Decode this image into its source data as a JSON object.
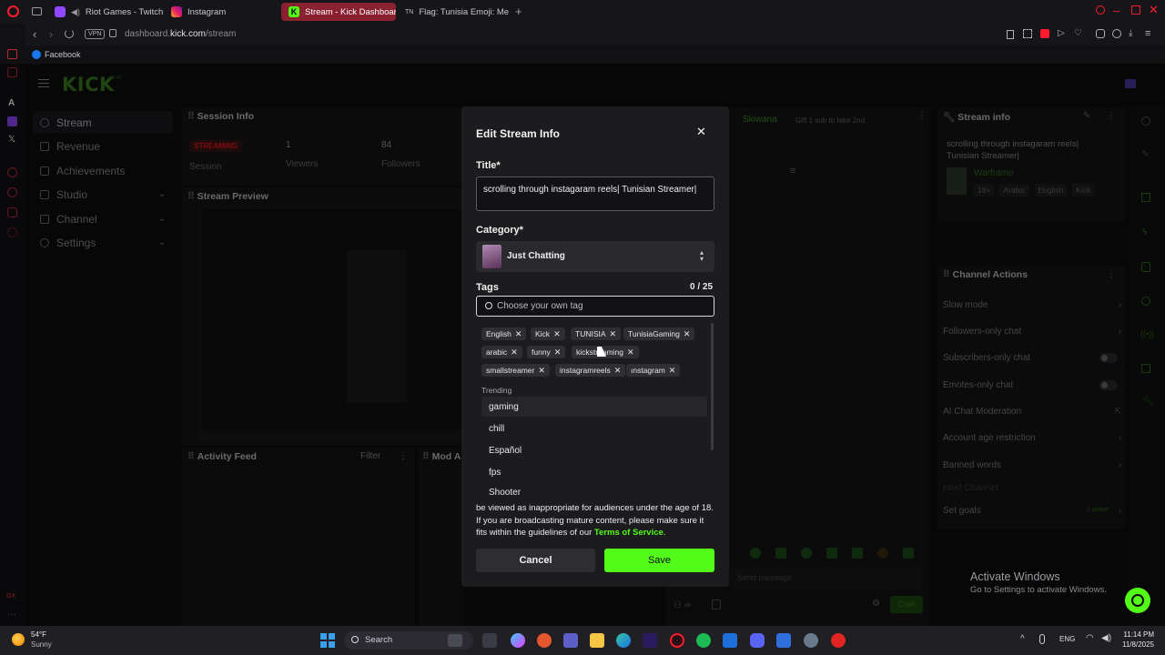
{
  "browser": {
    "tabs": [
      {
        "label": "Riot Games - Twitch",
        "icon": "twitch-icon",
        "active": false
      },
      {
        "label": "Instagram",
        "icon": "instagram-icon",
        "active": false
      },
      {
        "label": "Stream - Kick Dashboard",
        "icon": "kick-icon",
        "active": true
      },
      {
        "label": "Flag: Tunisia Emoji: Me",
        "icon": "emojipedia-icon",
        "active": false
      }
    ],
    "vpn_label": "VPN",
    "url_host": "dashboard.",
    "url_domain": "kick.com",
    "url_path": "/stream",
    "bookmark": "Facebook"
  },
  "sidebar": {
    "logo": "KICK",
    "logo_badge": "BETA",
    "items": [
      {
        "label": "Stream",
        "selected": true
      },
      {
        "label": "Revenue"
      },
      {
        "label": "Achievements"
      },
      {
        "label": "Studio",
        "chevron": true
      },
      {
        "label": "Channel",
        "chevron": true
      },
      {
        "label": "Settings",
        "chevron": true
      }
    ]
  },
  "session": {
    "title": "Session Info",
    "status": "STREAMING",
    "status_sub": "Session",
    "viewers_value": "1",
    "viewers_label": "Viewers",
    "followers_value": "84",
    "followers_label": "Followers"
  },
  "preview": {
    "title": "Stream Preview"
  },
  "activity": {
    "title": "Activity Feed",
    "filter": "Filter"
  },
  "mod": {
    "title": "Mod A"
  },
  "chat": {
    "username": "Skiwana",
    "gift_text": "Gift 1 sub to take 2nd",
    "placeholder": "Send message",
    "send_label": "Chat"
  },
  "stream_info": {
    "title": "Stream info",
    "stream_title": "scrolling through instagaram reels| Tunisian Streamer|",
    "category": "Warframe",
    "tags": [
      "18+",
      "Arabic",
      "English",
      "Kick"
    ]
  },
  "channel_actions": {
    "title": "Channel Actions",
    "items": [
      {
        "label": "Slow mode",
        "control": "arrow"
      },
      {
        "label": "Followers-only chat",
        "control": "arrow"
      },
      {
        "label": "Subscribers-only chat",
        "control": "toggle"
      },
      {
        "label": "Emotes-only chat",
        "control": "toggle"
      },
      {
        "label": "AI Chat Moderation",
        "control": "external"
      },
      {
        "label": "Account age restriction",
        "control": "arrow"
      },
      {
        "label": "Banned words",
        "control": "arrow"
      },
      {
        "label": "Host Channel",
        "control": "none"
      },
      {
        "label": "Set goals",
        "control": "arrow",
        "note": "1 active"
      }
    ]
  },
  "modal": {
    "heading": "Edit Stream Info",
    "title_label": "Title*",
    "title_value": "scrolling through instagaram reels| Tunisian Streamer|",
    "category_label": "Category*",
    "category_value": "Just Chatting",
    "tags_label": "Tags",
    "tags_count": "0 / 25",
    "tag_placeholder": "Choose your own tag",
    "tags": [
      "English",
      "Kick",
      "TUNISIA",
      "TunisiaGaming",
      "arabic",
      "funny",
      "kickstreaming",
      "smallstreamer",
      "instagramreels",
      "ınstagram"
    ],
    "trending_label": "Trending",
    "trending": [
      "gaming",
      "chill",
      "Español",
      "fps",
      "Shooter"
    ],
    "mature_text": "be viewed as inappropriate for audiences under the age of 18. If you are broadcasting mature content, please make sure it fits within the guidelines of our",
    "tos_link": "Terms of Service",
    "tos_period": ".",
    "cancel_label": "Cancel",
    "save_label": "Save"
  },
  "watermark": {
    "line1": "Activate Windows",
    "line2": "Go to Settings to activate Windows."
  },
  "taskbar": {
    "weather_temp": "54°F",
    "weather_desc": "Sunny",
    "search_label": "Search",
    "lang": "ENG",
    "time": "11:14 PM",
    "date": "11/8/2025"
  },
  "colors": {
    "kick_green": "#53fc18",
    "accent_tab": "#8a2131",
    "opera_red": "#ff1b2d",
    "streaming_red": "#e91916"
  }
}
